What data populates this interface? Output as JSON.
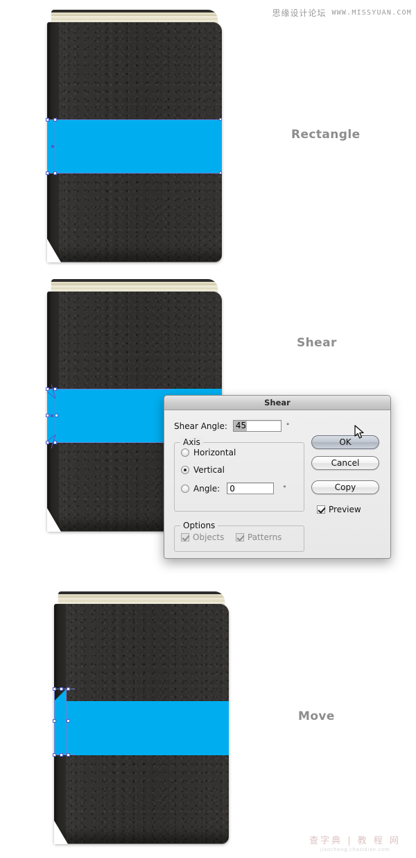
{
  "watermarks": {
    "top_cn": "思缘设计论坛",
    "top_url": "WWW.MISSYUAN.COM",
    "bottom_cn": "查字典 | 教 程 网",
    "bottom_url": "jiaocheng.chazidian.com"
  },
  "steps": [
    {
      "label": "Rectangle"
    },
    {
      "label": "Shear"
    },
    {
      "label": "Move"
    }
  ],
  "dialog": {
    "title": "Shear",
    "shear_angle_label": "Shear Angle:",
    "shear_angle_value": "45",
    "degree_symbol": "°",
    "axis_group_label": "Axis",
    "axis_options": [
      {
        "label": "Horizontal",
        "checked": false
      },
      {
        "label": "Vertical",
        "checked": true
      },
      {
        "label": "Angle:",
        "checked": false
      }
    ],
    "axis_angle_value": "0",
    "axis_angle_degree": "°",
    "options_group_label": "Options",
    "options": [
      {
        "label": "Objects",
        "checked": true,
        "enabled": false
      },
      {
        "label": "Patterns",
        "checked": true,
        "enabled": false
      }
    ],
    "buttons": {
      "ok": "OK",
      "cancel": "Cancel",
      "copy": "Copy"
    },
    "preview_label": "Preview",
    "preview_checked": true
  },
  "colors": {
    "band_blue": "#00aeef",
    "book_cover": "#2f2e2c",
    "page_cream": "#efeada",
    "label_gray": "#8d8d8d",
    "selection_blue": "#4b5ec7"
  }
}
